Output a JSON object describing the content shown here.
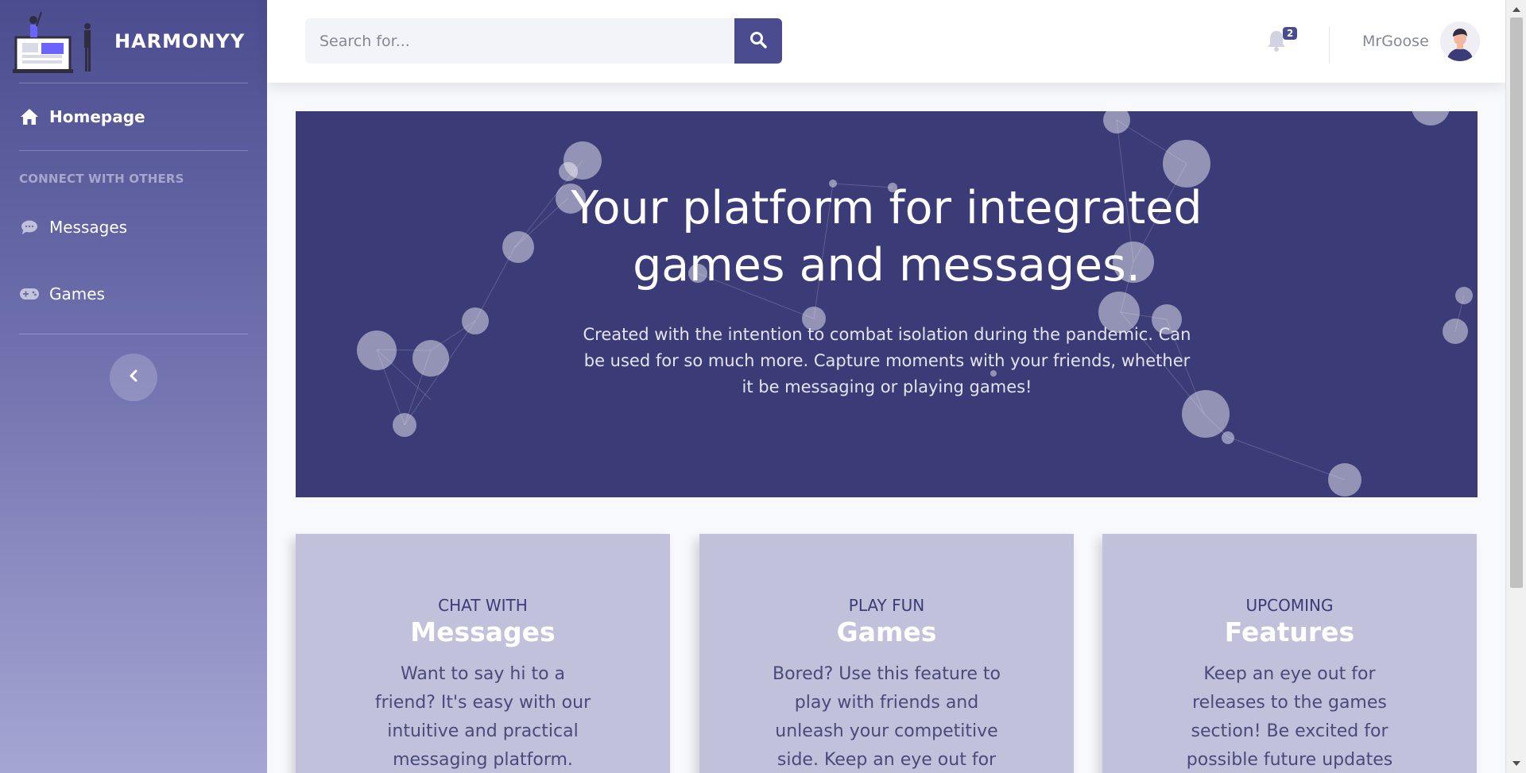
{
  "brand": {
    "name": "HARMONYY",
    "logo": "laptop-illustration-icon"
  },
  "sidebar": {
    "items": [
      {
        "label": "Homepage",
        "icon": "home-icon"
      },
      {
        "label": "Messages",
        "icon": "comment-icon"
      },
      {
        "label": "Games",
        "icon": "gamepad-icon"
      }
    ],
    "heading": "CONNECT WITH OTHERS",
    "toggle_icon": "chevron-left-icon"
  },
  "topbar": {
    "search_placeholder": "Search for...",
    "search_icon": "search-icon",
    "notification_count": "2",
    "bell_icon": "bell-icon",
    "user_name": "MrGoose"
  },
  "hero": {
    "title_line1": "Your platform for integrated",
    "title_line2": "games and messages.",
    "subtitle": "Created with the intention to combat isolation during the pandemic. Can be used for so much more. Capture moments with your friends, whether it be messaging or playing games!"
  },
  "cards": [
    {
      "pre": "CHAT WITH",
      "title": "Messages",
      "desc": "Want to say hi to a friend? It's easy with our intuitive and practical messaging platform."
    },
    {
      "pre": "PLAY FUN",
      "title": "Games",
      "desc": "Bored? Use this feature to play with friends and unleash your competitive side. Keep an eye out for"
    },
    {
      "pre": "UPCOMING",
      "title": "Features",
      "desc": "Keep an eye out for releases to the games section! Be excited for possible future updates"
    }
  ],
  "colors": {
    "primary": "#4b4c8f",
    "hero_bg": "#3b3b78",
    "card_bg": "#c1c1dc"
  }
}
